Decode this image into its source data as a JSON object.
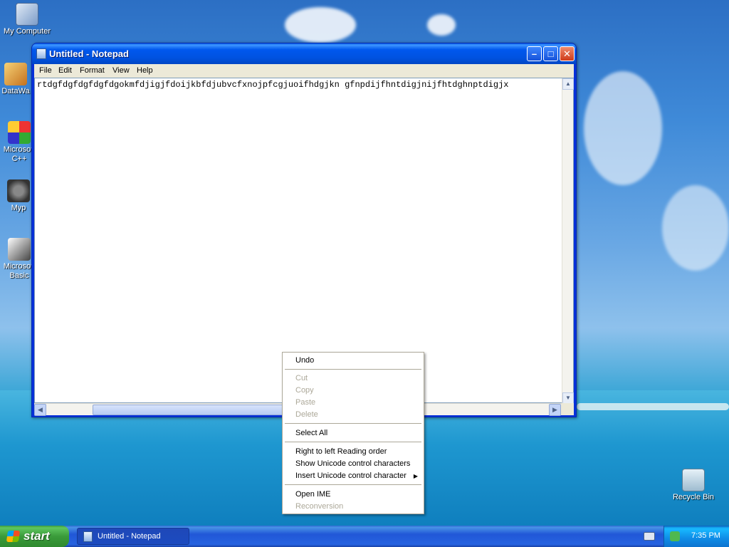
{
  "desktop": {
    "icons": [
      {
        "label": "My Computer",
        "icon": "computer-icon"
      },
      {
        "label": "DataWa",
        "icon": "shortcut-icon"
      },
      {
        "label": "Microsoft C++",
        "icon": "shortcut-icon"
      },
      {
        "label": "Myp",
        "icon": "shortcut-icon"
      },
      {
        "label": "Microsoft Basic",
        "icon": "shortcut-icon"
      },
      {
        "label": "Recycle Bin",
        "icon": "recycle-bin-icon"
      }
    ]
  },
  "window": {
    "title": "Untitled - Notepad",
    "buttons": {
      "minimize": "–",
      "maximize": "□",
      "close": "✕"
    },
    "menu": [
      "File",
      "Edit",
      "Format",
      "View",
      "Help"
    ],
    "text": "rtdgfdgfdgfdgfdgokmfdjigjfdoijkbfdjubvcfxnojpfcgjuoifhdgjkn gfnpdijfhntdigjnijfhtdghnptdigjx"
  },
  "context_menu": {
    "items": [
      {
        "label": "Undo",
        "enabled": true
      },
      {
        "label": "Cut",
        "enabled": false
      },
      {
        "label": "Copy",
        "enabled": false
      },
      {
        "label": "Paste",
        "enabled": false
      },
      {
        "label": "Delete",
        "enabled": false
      },
      {
        "label": "Select All",
        "enabled": true
      },
      {
        "label": "Right to left Reading order",
        "enabled": true
      },
      {
        "label": "Show Unicode control characters",
        "enabled": true
      },
      {
        "label": "Insert Unicode control character",
        "enabled": true,
        "submenu": true
      },
      {
        "label": "Open IME",
        "enabled": true
      },
      {
        "label": "Reconversion",
        "enabled": false
      }
    ]
  },
  "taskbar": {
    "start_label": "start",
    "task_label": "Untitled - Notepad",
    "clock": "7:35 PM"
  },
  "colors": {
    "titlebar": "#0058ee",
    "taskbar": "#2157d7",
    "start_button": "#3a9b3a",
    "disabled_text": "#aca899"
  }
}
